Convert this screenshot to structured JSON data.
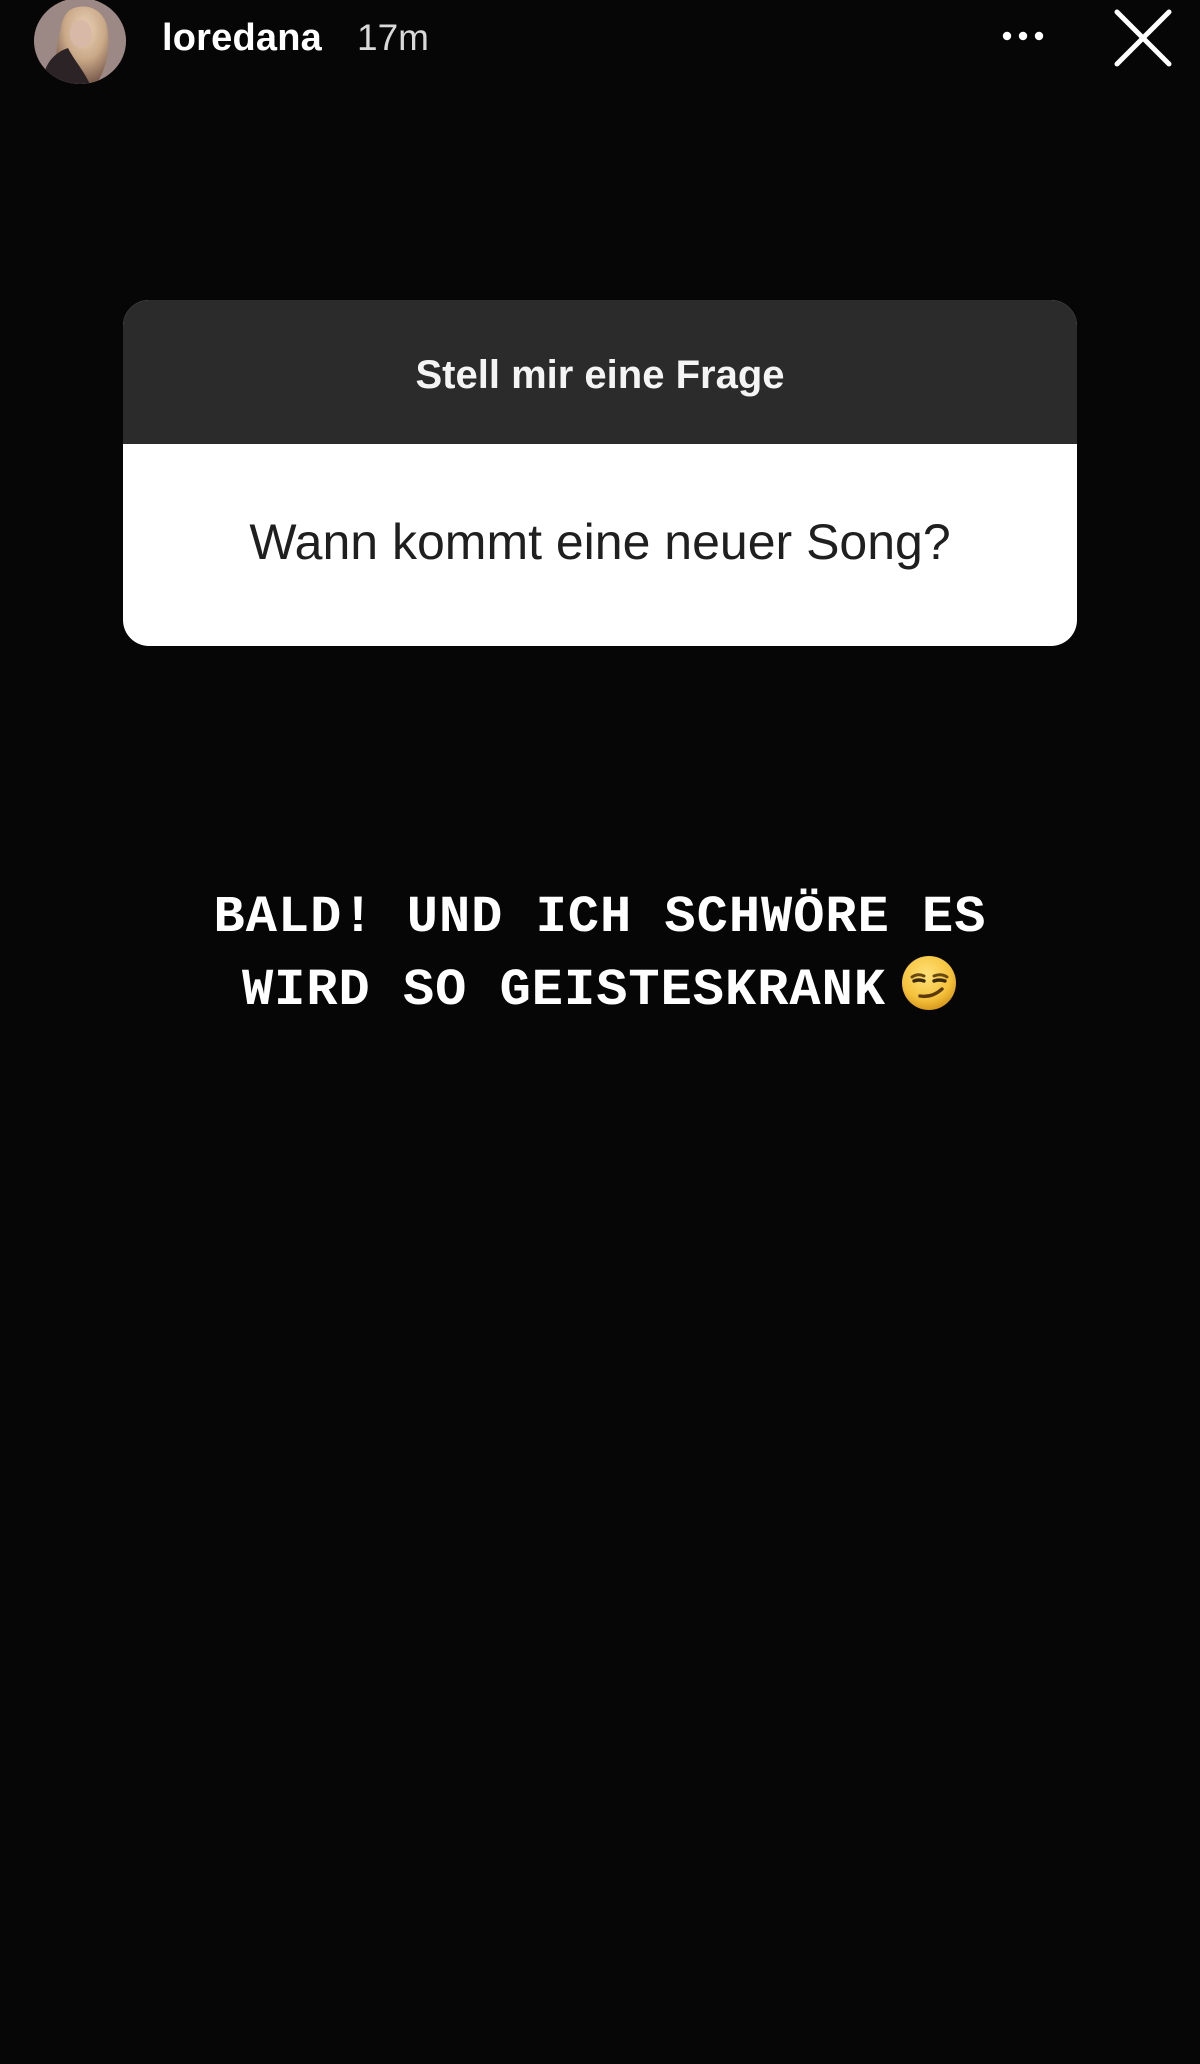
{
  "story": {
    "username": "loredana",
    "timestamp": "17m",
    "avatar_icon": "profile-avatar",
    "more_icon": "more-horizontal-icon",
    "close_icon": "close-icon"
  },
  "question_sticker": {
    "title": "Stell mir eine Frage",
    "question": "Wann kommt eine neuer Song?"
  },
  "answer": {
    "line1": "BALD! UND ICH SCHWÖRE ES",
    "line2": "WIRD SO GEISTESKRANK",
    "emoji": "smirking-face-emoji"
  },
  "colors": {
    "background": "#060606",
    "sticker_header": "#2b2b2b",
    "sticker_body": "#ffffff",
    "emoji": "#f5c23c"
  }
}
